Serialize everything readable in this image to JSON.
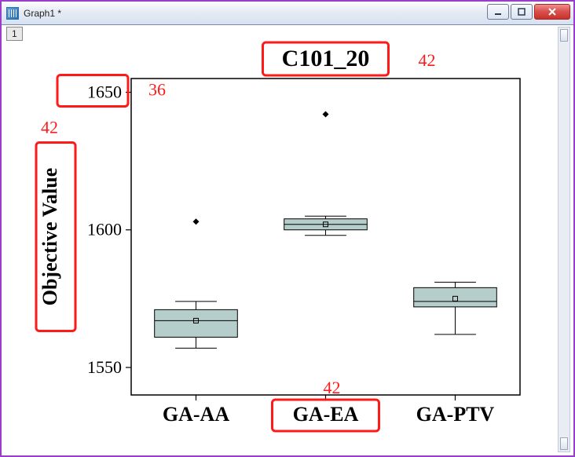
{
  "window": {
    "title": "Graph1 *",
    "tab": "1"
  },
  "chart_data": {
    "type": "boxplot",
    "title": "C101_20",
    "ylabel": "Objective Value",
    "xlabel": "",
    "ylim": [
      1540,
      1655
    ],
    "yticks": [
      1550,
      1600,
      1650
    ],
    "categories": [
      "GA-AA",
      "GA-EA",
      "GA-PTV"
    ],
    "series": [
      {
        "name": "GA-AA",
        "q1": 1561,
        "median": 1567,
        "q3": 1571,
        "whisker_low": 1557,
        "whisker_high": 1574,
        "mean": 1567,
        "outliers": [
          1603
        ]
      },
      {
        "name": "GA-EA",
        "q1": 1600,
        "median": 1602,
        "q3": 1604,
        "whisker_low": 1598,
        "whisker_high": 1605,
        "mean": 1602,
        "outliers": [
          1642
        ]
      },
      {
        "name": "GA-PTV",
        "q1": 1572,
        "median": 1574,
        "q3": 1579,
        "whisker_low": 1562,
        "whisker_high": 1581,
        "mean": 1575,
        "outliers": []
      }
    ]
  },
  "annotations": {
    "title_box_label": "42",
    "ytick_box_label": "36",
    "ylabel_box_label": "42",
    "xlabel_box_label": "42"
  }
}
